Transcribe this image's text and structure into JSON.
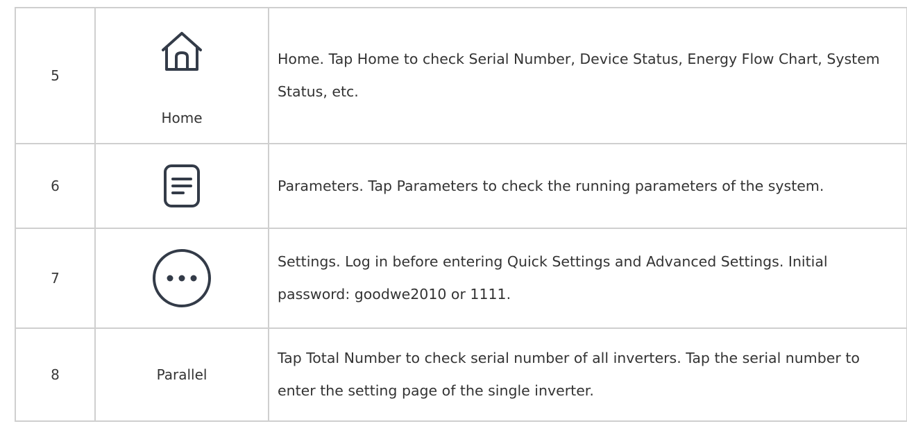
{
  "rows": [
    {
      "number": "5",
      "icon": "home-icon",
      "label": "Home",
      "description": "Home. Tap Home to check Serial Number,  Device Status,  Energy Flow Chart,  System Status,  etc."
    },
    {
      "number": "6",
      "icon": "document-icon",
      "label": "",
      "description": "Parameters. Tap Parameters to check the running parameters of the system."
    },
    {
      "number": "7",
      "icon": "more-circle-icon",
      "label": "",
      "description": "Settings. Log in before entering Quick Settings and Advanced Settings. Initial password:  goodwe2010 or 1111."
    },
    {
      "number": "8",
      "icon": "",
      "label": "Parallel",
      "description": "Tap Total Number to check serial number of all inverters. Tap the serial number to enter the setting page of the single inverter."
    }
  ],
  "colors": {
    "text": "#333333",
    "border": "#cfcfcf",
    "icon_stroke": "#333b48"
  }
}
